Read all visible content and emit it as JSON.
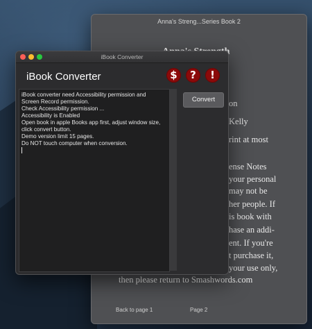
{
  "books_window": {
    "title": "Anna's Streng...Series Book 2",
    "heading": "Anna's Strength",
    "lines": [
      "on",
      "Kelly",
      "rint at most",
      "ense Notes",
      "your personal",
      "may not be",
      "her people. If",
      "is book with",
      "hase an addi-",
      "ent. If you're",
      "t purchase it,",
      "your use only,",
      "then please return to Smashwords.com"
    ],
    "footer_left": "Back to page 1",
    "footer_right": "Page 2"
  },
  "converter_window": {
    "titlebar_title": "iBook Converter",
    "header_title": "iBook Converter",
    "icons": {
      "dollar": "$",
      "question": "?",
      "exclaim": "!"
    },
    "icon_color": "#8b0a0a",
    "log_lines": [
      "iBook converter need Accessibility permission and Screen Record permission.",
      "Check Accessibility permission ...",
      "Accessibility is Enabled",
      "Open book in apple Books app first, adjust window size, click convert button.",
      "Demo version limit 15 pages.",
      "Do NOT touch computer when conversion."
    ],
    "convert_label": "Convert"
  }
}
